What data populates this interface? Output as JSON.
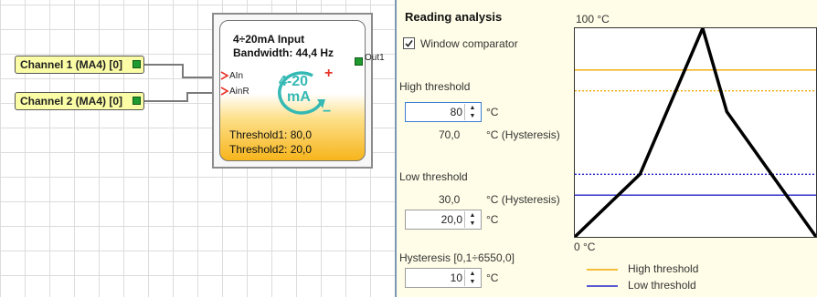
{
  "canvas": {
    "inputs": [
      {
        "label": "Channel 1 (MA4) [0]"
      },
      {
        "label": "Channel 2 (MA4) [0]"
      }
    ],
    "block": {
      "title": "4÷20mA Input",
      "bandwidth": "Bandwidth: 44,4 Hz",
      "port_in1": "AIn",
      "port_in2": "AinR",
      "icon_text_top": "4-20",
      "icon_text_bottom": "mA",
      "threshold1": "Threshold1: 80,0",
      "threshold2": "Threshold2: 20,0",
      "output": "Out1"
    }
  },
  "panel": {
    "title": "Reading analysis",
    "window_comparator": {
      "label": "Window comparator",
      "checked": true
    },
    "high_threshold": {
      "label": "High threshold",
      "value": "80",
      "unit": "°C",
      "hysteresis_value": "70,0",
      "hysteresis_label": "°C (Hysteresis)"
    },
    "low_threshold": {
      "label": "Low threshold",
      "hysteresis_value": "30,0",
      "hysteresis_label": "°C (Hysteresis)",
      "value": "20,0",
      "unit": "°C"
    },
    "hysteresis": {
      "label": "Hysteresis [0,1÷6550,0]",
      "value": "10",
      "unit": "°C"
    }
  },
  "chart_data": {
    "type": "line",
    "y_top_label": "100 °C",
    "y_bottom_label": "0 °C",
    "ylim": [
      0,
      100
    ],
    "series": [
      {
        "name": "High threshold",
        "color": "#f0a800",
        "value": 80,
        "hysteresis": 70
      },
      {
        "name": "Low threshold",
        "color": "#2424c8",
        "value": 20,
        "hysteresis": 30
      }
    ],
    "signal": {
      "color": "#000000",
      "x": [
        0,
        0.27,
        0.53,
        0.63,
        1.0
      ],
      "y": [
        0,
        30,
        100,
        60,
        0
      ]
    }
  }
}
